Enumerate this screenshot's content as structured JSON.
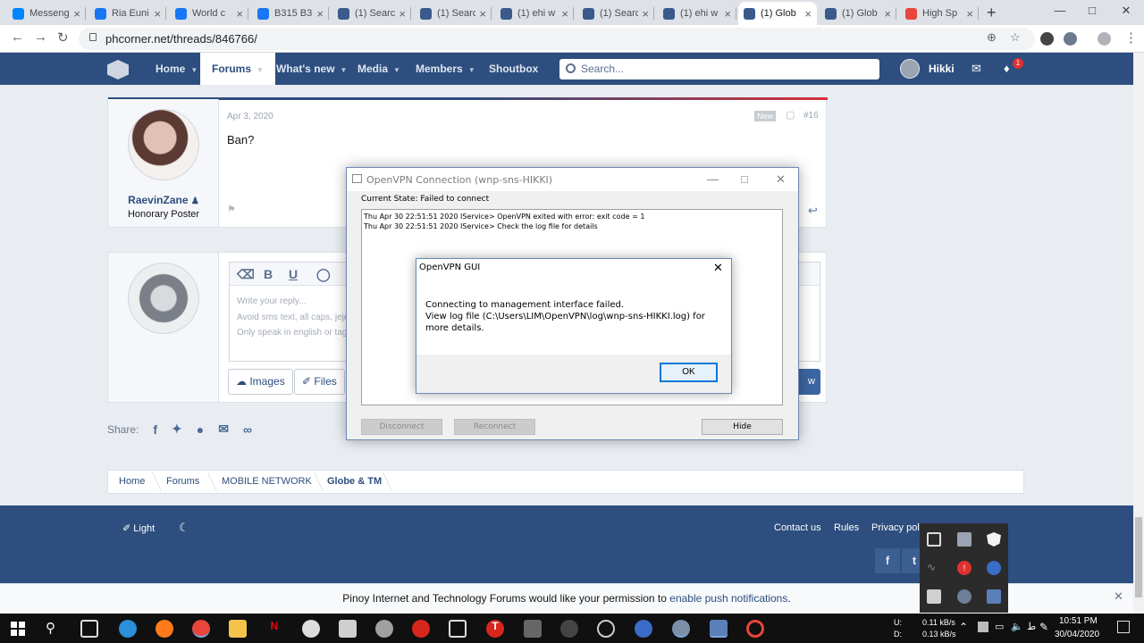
{
  "browser": {
    "tabs": [
      {
        "title": "Messeng",
        "favicon_color": "#0084ff"
      },
      {
        "title": "Ria Euni",
        "favicon_color": "#1877f2"
      },
      {
        "title": "World c",
        "favicon_color": "#1877f2"
      },
      {
        "title": "B315 B3",
        "favicon_color": "#1877f2"
      },
      {
        "title": "(1) Searc",
        "favicon_color": "#3a5a8c"
      },
      {
        "title": "(1) Searc",
        "favicon_color": "#3a5a8c"
      },
      {
        "title": "(1) ehi w",
        "favicon_color": "#3a5a8c"
      },
      {
        "title": "(1) Searc",
        "favicon_color": "#3a5a8c"
      },
      {
        "title": "(1) ehi w",
        "favicon_color": "#3a5a8c"
      },
      {
        "title": "(1) Glob",
        "favicon_color": "#3a5a8c",
        "active": true
      },
      {
        "title": "(1) Glob",
        "favicon_color": "#3a5a8c"
      },
      {
        "title": "High Sp",
        "favicon_color": "#e8453c"
      }
    ],
    "url": "phcorner.net/threads/846766/"
  },
  "forum_nav": {
    "items": [
      {
        "label": "Home"
      },
      {
        "label": "Forums",
        "active": true
      },
      {
        "label": "What's new"
      },
      {
        "label": "Media"
      },
      {
        "label": "Members"
      },
      {
        "label": "Shoutbox"
      }
    ],
    "search_placeholder": "Search...",
    "username": "Hikki",
    "alert_count": "1"
  },
  "post": {
    "author": "RaevinZane",
    "author_title": "Honorary Poster",
    "date": "Apr 3, 2020",
    "new_label": "New",
    "number": "#16",
    "body": "Ban?"
  },
  "reply": {
    "placeholder_lines": [
      "Write your reply...",
      "Avoid sms text, all caps, jeje",
      "Only speak in english or tag"
    ],
    "images_label": "Images",
    "files_label": "Files",
    "post_label": "w"
  },
  "share": {
    "label": "Share:"
  },
  "breadcrumb": [
    "Home",
    "Forums",
    "MOBILE NETWORK",
    "Globe & TM"
  ],
  "footer": {
    "light_label": "Light",
    "links": [
      "Contact us",
      "Rules",
      "Privacy pol"
    ]
  },
  "push_bar": {
    "text": "Pinoy Internet and Technology Forums would like your permission to ",
    "link": "enable push notifications",
    "suffix": "."
  },
  "vpn_window": {
    "title": "OpenVPN Connection (wnp-sns-HIKKI)",
    "state": "Current State: Failed to connect",
    "log": [
      "Thu Apr 30 22:51:51 2020 IService> OpenVPN exited with error: exit code = 1",
      "Thu Apr 30 22:51:51 2020 IService> Check the log file for details"
    ],
    "disconnect_label": "Disconnect",
    "reconnect_label": "Reconnect",
    "hide_label": "Hide"
  },
  "error_dialog": {
    "title": "OpenVPN GUI",
    "message_line1": "Connecting to management interface failed.",
    "message_line2": "View log file (C:\\Users\\LIM\\OpenVPN\\log\\wnp-sns-HIKKI.log) for more details.",
    "ok_label": "OK"
  },
  "taskbar": {
    "net_up_label": "U:",
    "net_down_label": "D:",
    "net_up": "0.11 kB/s",
    "net_down": "0.13 kB/s",
    "time": "10:51 PM",
    "date": "30/04/2020"
  }
}
